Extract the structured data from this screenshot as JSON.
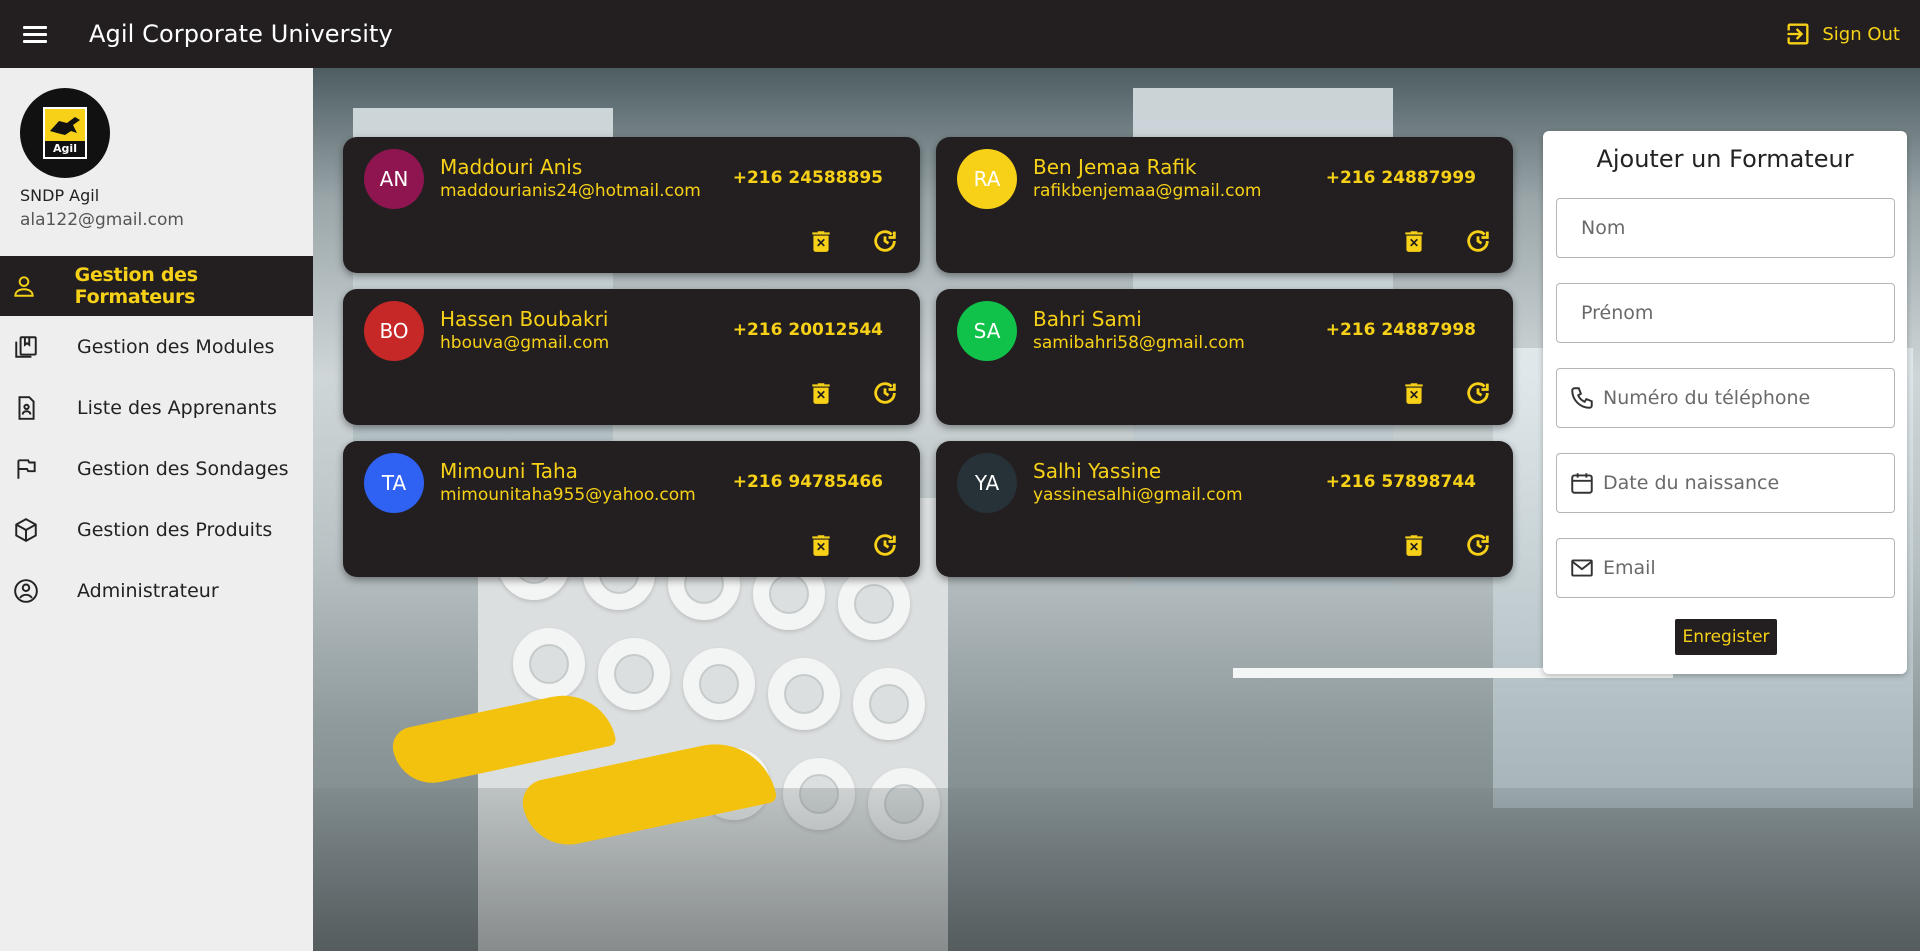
{
  "header": {
    "title": "Agil Corporate University",
    "menu_icon": "hamburger-icon",
    "signout_label": "Sign Out",
    "signout_icon": "logout-icon"
  },
  "profile": {
    "logo_text": "Agil",
    "name": "SNDP Agil",
    "email": "ala122@gmail.com"
  },
  "sidebar": {
    "items": [
      {
        "label": "Gestion des Formateurs",
        "icon": "person-icon",
        "active": true
      },
      {
        "label": "Gestion des Modules",
        "icon": "book-icon",
        "active": false
      },
      {
        "label": "Liste des Apprenants",
        "icon": "badge-document-icon",
        "active": false
      },
      {
        "label": "Gestion des Sondages",
        "icon": "flag-icon",
        "active": false
      },
      {
        "label": "Gestion des Produits",
        "icon": "box-icon",
        "active": false
      },
      {
        "label": "Administrateur",
        "icon": "account-circle-icon",
        "active": false
      }
    ]
  },
  "trainers": [
    {
      "initials": "AN",
      "name": "Maddouri Anis",
      "email": "maddourianis24@hotmail.com",
      "phone": "+216 24588895",
      "avatar_color": "#8e1550"
    },
    {
      "initials": "RA",
      "name": "Ben Jemaa Rafik",
      "email": "rafikbenjemaa@gmail.com",
      "phone": "+216 24887999",
      "avatar_color": "#f7d117"
    },
    {
      "initials": "BO",
      "name": "Hassen Boubakri",
      "email": "hbouva@gmail.com",
      "phone": "+216 20012544",
      "avatar_color": "#c62828"
    },
    {
      "initials": "SA",
      "name": "Bahri Sami",
      "email": "samibahri58@gmail.com",
      "phone": "+216 24887998",
      "avatar_color": "#10c24a"
    },
    {
      "initials": "TA",
      "name": "Mimouni Taha",
      "email": "mimounitaha955@yahoo.com",
      "phone": "+216 94785466",
      "avatar_color": "#2f62f2"
    },
    {
      "initials": "YA",
      "name": "Salhi Yassine",
      "email": "yassinesalhi@gmail.com",
      "phone": "+216 57898744",
      "avatar_color": "#263238"
    }
  ],
  "card_actions": {
    "delete_icon": "delete-icon",
    "reset_icon": "refresh-icon"
  },
  "form": {
    "title": "Ajouter un Formateur",
    "nom_placeholder": "Nom",
    "prenom_placeholder": "Prénom",
    "phone_placeholder": "Numéro du téléphone",
    "phone_icon": "phone-icon",
    "date_placeholder": "Date du naissance",
    "date_icon": "calendar-icon",
    "email_placeholder": "Email",
    "email_icon": "mail-icon",
    "save_label": "Enregister"
  },
  "colors": {
    "accent": "#f7d117",
    "dark": "#231f20",
    "sidebar_bg": "#eeeeee"
  }
}
